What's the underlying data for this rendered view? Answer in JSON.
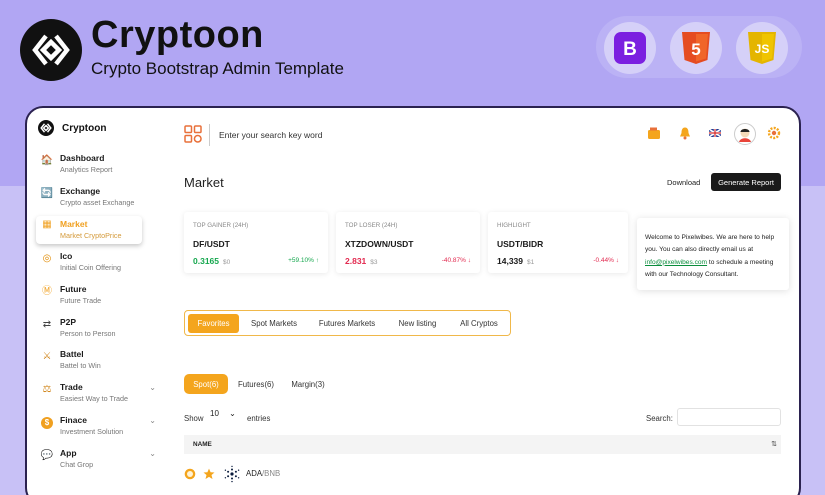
{
  "banner": {
    "title": "Cryptoon",
    "subtitle": "Crypto Bootstrap Admin Template",
    "tech": [
      {
        "name": "bootstrap-icon",
        "glyph": "B",
        "color": "#7b1fe0"
      },
      {
        "name": "html5-icon",
        "glyph": "5",
        "color": "#e54c21"
      },
      {
        "name": "javascript-icon",
        "glyph": "JS",
        "color": "#e4b500"
      }
    ]
  },
  "sidebar": {
    "brand": "Cryptoon",
    "items": [
      {
        "title": "Dashboard",
        "subtitle": "Analytics Report",
        "icon": "home-icon",
        "glyph": "🏠"
      },
      {
        "title": "Exchange",
        "subtitle": "Crypto asset Exchange",
        "icon": "exchange-icon",
        "glyph": "🔄"
      },
      {
        "title": "Market",
        "subtitle": "Market CryptoPrice",
        "icon": "market-icon",
        "glyph": "▦"
      },
      {
        "title": "Ico",
        "subtitle": "Initial Coin Offering",
        "icon": "ico-icon",
        "glyph": "◎"
      },
      {
        "title": "Future",
        "subtitle": "Future Trade",
        "icon": "future-icon",
        "glyph": "Ⓜ"
      },
      {
        "title": "P2P",
        "subtitle": "Person to Person",
        "icon": "p2p-icon",
        "glyph": "⇄"
      },
      {
        "title": "Battel",
        "subtitle": "Battel to Win",
        "icon": "battel-icon",
        "glyph": "⚔"
      },
      {
        "title": "Trade",
        "subtitle": "Easiest Way to Trade",
        "icon": "trade-icon",
        "glyph": "⚖"
      },
      {
        "title": "Finace",
        "subtitle": "Investment Solution",
        "icon": "finance-icon",
        "glyph": "$"
      },
      {
        "title": "App",
        "subtitle": "Chat Grop",
        "icon": "app-icon",
        "glyph": "💬"
      }
    ]
  },
  "topbar": {
    "search_placeholder": "Enter your search key word",
    "icons": [
      "wallet-icon",
      "bell-icon",
      "uk-flag-icon",
      "avatar",
      "settings-icon"
    ]
  },
  "page": {
    "title": "Market",
    "download_label": "Download",
    "report_label": "Generate Report"
  },
  "cards": [
    {
      "label": "TOP GAINER (24H)",
      "pair": "DF/USDT",
      "price": "0.3165",
      "usd": "$0",
      "change": "+59.10%",
      "arrow": "↑",
      "price_color": "#15a74e",
      "change_color": "#15a74e"
    },
    {
      "label": "TOP LOSER (24H)",
      "pair": "XTZDOWN/USDT",
      "price": "2.831",
      "usd": "$3",
      "change": "-40.87%",
      "arrow": "↓",
      "price_color": "#e2294f",
      "change_color": "#e2294f"
    },
    {
      "label": "HIGHLIGHT",
      "pair": "USDT/BIDR",
      "price": "14,339",
      "usd": "$1",
      "change": "-0.44%",
      "arrow": "↓",
      "price_color": "#1a1a1a",
      "change_color": "#e2294f"
    }
  ],
  "welcome": {
    "text_before": "Welcome to Pixelwibes. We are here to help you. You can also directly email us at ",
    "email": "info@pixelwibes.com",
    "text_after": " to schedule a meeting with our Technology Consultant."
  },
  "market_tabs": [
    "Favorites",
    "Spot Markets",
    "Futures Markets",
    "New listing",
    "All Cryptos"
  ],
  "sub_tabs": [
    "Spot(6)",
    "Futures(6)",
    "Margin(3)"
  ],
  "table": {
    "show_label": "Show",
    "show_value": "10",
    "entries_label": "entries",
    "search_label": "Search:",
    "column_name": "NAME",
    "rows": [
      {
        "base": "ADA",
        "quote": "/BNB"
      }
    ]
  }
}
